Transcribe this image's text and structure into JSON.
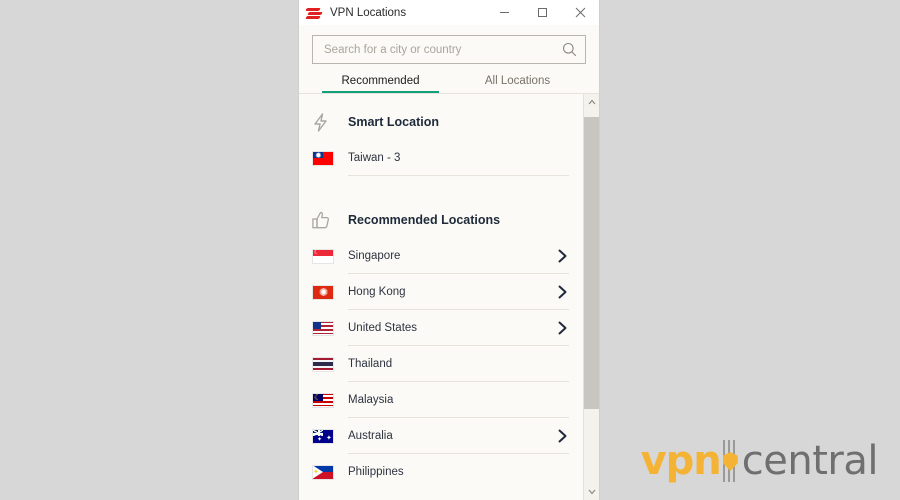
{
  "desktop": {
    "background": "#d7d7d7"
  },
  "watermark": {
    "vpn": "vpn",
    "central": "central",
    "vpn_color": "#f5b335",
    "central_color": "#6f6f6f"
  },
  "window": {
    "title": "VPN Locations",
    "logo_icon": "expressvpn-logo-icon",
    "controls": {
      "minimize": "minimize-icon",
      "maximize": "maximize-icon",
      "close": "close-icon"
    }
  },
  "search": {
    "placeholder": "Search for a city or country",
    "value": "",
    "icon": "search-icon"
  },
  "tabs": [
    {
      "label": "Recommended",
      "active": true
    },
    {
      "label": "All Locations",
      "active": false
    }
  ],
  "accent_color": "#12a07a",
  "sections": [
    {
      "icon": "lightning-bolt-icon",
      "title": "Smart Location",
      "rows": [
        {
          "name": "Taiwan - 3",
          "flag": "tw",
          "chevron": false
        }
      ]
    },
    {
      "icon": "thumbs-up-icon",
      "title": "Recommended Locations",
      "rows": [
        {
          "name": "Singapore",
          "flag": "sg",
          "chevron": true
        },
        {
          "name": "Hong Kong",
          "flag": "hk",
          "chevron": true
        },
        {
          "name": "United States",
          "flag": "us",
          "chevron": true
        },
        {
          "name": "Thailand",
          "flag": "th",
          "chevron": false
        },
        {
          "name": "Malaysia",
          "flag": "my",
          "chevron": false
        },
        {
          "name": "Australia",
          "flag": "au",
          "chevron": true
        },
        {
          "name": "Philippines",
          "flag": "ph",
          "chevron": false
        }
      ]
    }
  ],
  "scrollbar": {
    "up_arrow": "chevron-up-icon",
    "down_arrow": "chevron-down-icon",
    "thumb_top_percent": 2,
    "thumb_height_percent": 78
  }
}
